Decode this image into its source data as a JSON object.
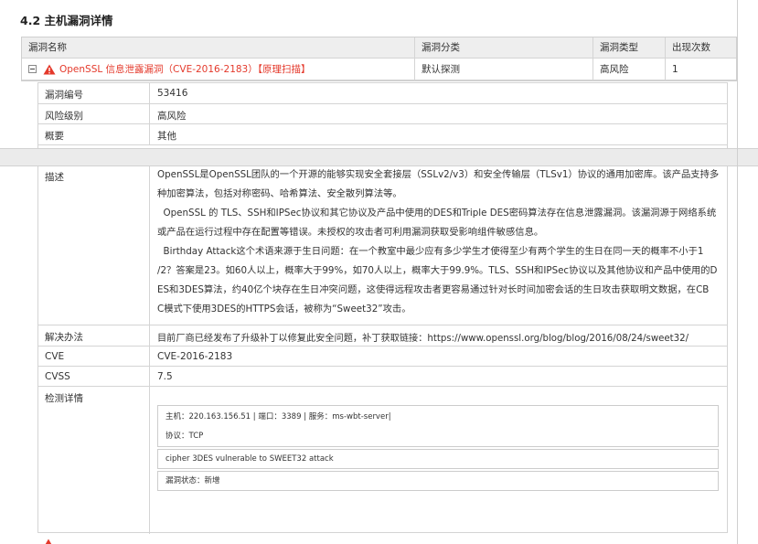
{
  "section": {
    "title": "4.2 主机漏洞详情"
  },
  "table": {
    "headers": {
      "name": "漏洞名称",
      "category": "漏洞分类",
      "type": "漏洞类型",
      "count": "出现次数"
    },
    "vuln": {
      "name": "OpenSSL 信息泄露漏洞（CVE-2016-2183）【原理扫描】",
      "category": "默认探测",
      "type": "高风险",
      "count": "1"
    }
  },
  "details": {
    "id_label": "漏洞编号",
    "id_value": "53416",
    "risk_label": "风险级别",
    "risk_value": "高风险",
    "summary_label": "概要",
    "summary_value": "其他",
    "desc_label": "描述",
    "desc_p1_l1": "OpenSSL是OpenSSL团队的一个开源的能够实现安全套接层（SSLv2/v3）和安全传输层（TLSv1）协议的通用加密库。该产品支持多",
    "desc_p1_l2": "种加密算法，包括对称密码、哈希算法、安全散列算法等。",
    "desc_p2_l1": "  OpenSSL 的 TLS、SSH和IPSec协议和其它协议及产品中使用的DES和Triple DES密码算法存在信息泄露漏洞。该漏洞源于网络系统",
    "desc_p2_l2": "或产品在运行过程中存在配置等错误。未授权的攻击者可利用漏洞获取受影响组件敏感信息。",
    "desc_p3_l1": "  Birthday Attack这个术语来源于生日问题：在一个教室中最少应有多少学生才使得至少有两个学生的生日在同一天的概率不小于1",
    "desc_p3_l2": "/2？答案是23。如60人以上，概率大于99%，如70人以上，概率大于99.9%。TLS、SSH和IPSec协议以及其他协议和产品中使用的D",
    "desc_p3_l3": "ES和3DES算法，约40亿个块存在生日冲突问题，这使得远程攻击者更容易通过针对长时间加密会话的生日攻击获取明文数据，在CB",
    "desc_p3_l4": "C模式下使用3DES的HTTPS会话，被称为“Sweet32”攻击。",
    "solution_label": "解决办法",
    "solution_value": "目前厂商已经发布了升级补丁以修复此安全问题，补丁获取链接：https://www.openssl.org/blog/blog/2016/08/24/sweet32/",
    "cve_label": "CVE",
    "cve_value": "CVE-2016-2183",
    "cvss_label": "CVSS",
    "cvss_value": "7.5",
    "detect_label": "检测详情",
    "detect_host": "主机：220.163.156.51 | 端口：3389 | 服务：ms-wbt-server|",
    "detect_proto": "协议：TCP",
    "detect_msg": "cipher 3DES vulnerable to SWEET32 attack",
    "detect_status": "漏洞状态：新增"
  },
  "colors": {
    "risk_red": "#e4392b",
    "header_bg": "#eeeeee",
    "border": "#d4d4d4"
  },
  "icons": {
    "warning": "warning-triangle-icon",
    "collapse": "collapse-minus-icon"
  }
}
